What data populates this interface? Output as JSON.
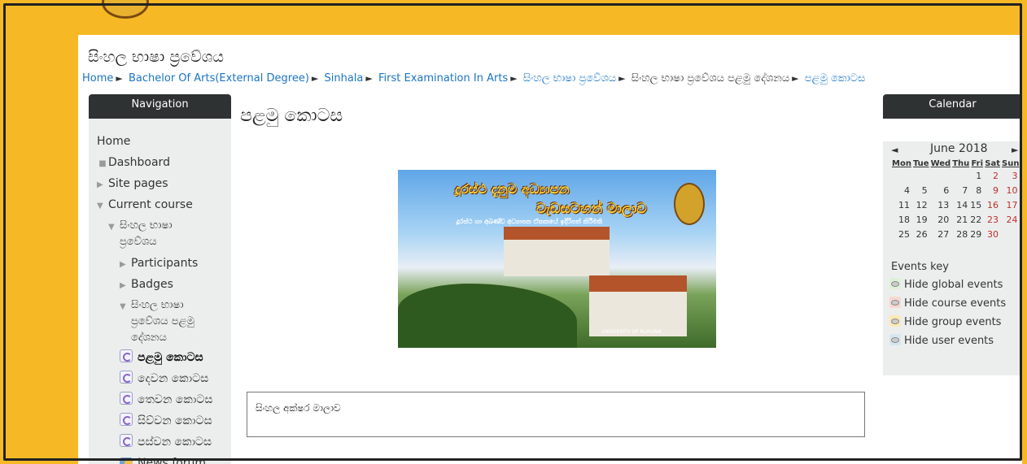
{
  "site": {
    "title": "සිංහල භාෂා ප්‍රවේශය"
  },
  "breadcrumb": {
    "items": [
      "Home",
      "Bachelor Of Arts(External Degree)",
      "Sinhala",
      "First Examination In Arts",
      "සිංහල භාෂා ප්‍රවේශය",
      "සිංහල භාෂා ප්‍රවේශය පළමු දේශනය",
      "පළමු කොටස"
    ],
    "separator": "►"
  },
  "navigation": {
    "header": "Navigation",
    "home": "Home",
    "dashboard": "Dashboard",
    "site_pages": "Site pages",
    "current_course": "Current course",
    "course_name": "සිංහල භාෂා ප්‍රවේශය",
    "participants": "Participants",
    "badges": "Badges",
    "section_name": "සිංහල භාෂා ප්‍රවේශය පළමු දේශනය",
    "resources": [
      "පළමු කොටස",
      "දෙවන කොටස",
      "තෙවන කොටස",
      "සිව්වන කොටස",
      "පස්වන කොටස"
    ],
    "news_forum": "News forum"
  },
  "main": {
    "heading": "පළමු කොටස",
    "banner": {
      "line1": "දූරස්ථ දැනුම අධ්‍යාපන",
      "line2": "වැඩසටහන් මාලාව",
      "subtitle": "දූරස්ථ හා අඛණ්ඩ අධ්‍යාපන ඒකකයේ ඉදිරිපත් කිරීමකි",
      "caption": "UNIVERSITY OF RUHUNA"
    },
    "text_box": "සිංහල අක්ෂර මාලාව"
  },
  "calendar": {
    "header": "Calendar",
    "prev": "◄",
    "next": "►",
    "month": "June 2018",
    "days": [
      "Mon",
      "Tue",
      "Wed",
      "Thu",
      "Fri",
      "Sat",
      "Sun"
    ],
    "weeks": [
      [
        "",
        "",
        "",
        "",
        "1",
        "2",
        "3"
      ],
      [
        "4",
        "5",
        "6",
        "7",
        "8",
        "9",
        "10"
      ],
      [
        "11",
        "12",
        "13",
        "14",
        "15",
        "16",
        "17"
      ],
      [
        "18",
        "19",
        "20",
        "21",
        "22",
        "23",
        "24"
      ],
      [
        "25",
        "26",
        "27",
        "28",
        "29",
        "30",
        ""
      ]
    ],
    "events_key": "Events key",
    "events": [
      {
        "label": "Hide global events",
        "color": "#dff0d8"
      },
      {
        "label": "Hide course events",
        "color": "#f7d8d0"
      },
      {
        "label": "Hide group events",
        "color": "#fbe9b6"
      },
      {
        "label": "Hide user events",
        "color": "#d6e6ee"
      }
    ]
  },
  "colors": {
    "accent_bg": "#f6b925",
    "link": "#1b74c5",
    "block_header": "#2f3233",
    "weekend": "#c0302a"
  }
}
